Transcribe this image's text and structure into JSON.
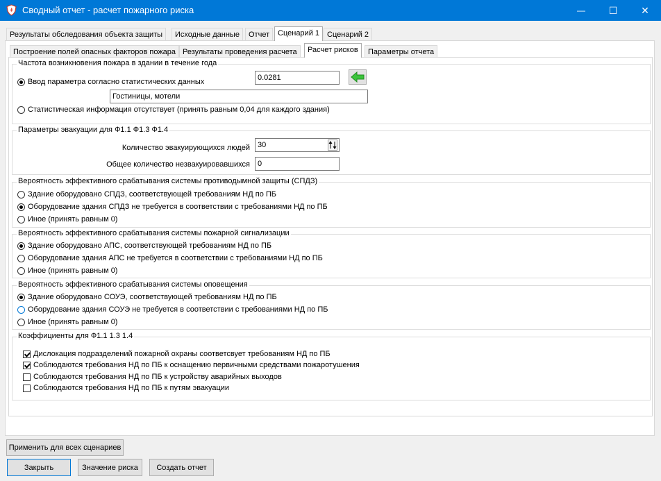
{
  "window": {
    "title": "Сводный отчет - расчет пожарного риска",
    "minimize_glyph": "—",
    "maximize_glyph": "☐",
    "close_glyph": "✕",
    "accent_color": "#0078d7"
  },
  "main_tabs": [
    {
      "label": "Результаты обследования объекта защиты"
    },
    {
      "label": "Исходные данные"
    },
    {
      "label": "Отчет"
    },
    {
      "label": "Сценарий 1"
    },
    {
      "label": "Сценарий 2"
    }
  ],
  "sub_tabs": [
    {
      "label": "Построение полей опасных факторов пожара"
    },
    {
      "label": "Результаты проведения расчета"
    },
    {
      "label": "Расчет рисков"
    },
    {
      "label": "Параметры отчета"
    }
  ],
  "fire_frequency": {
    "title": "Частота возникновения пожара в здании в течение года",
    "option_stats": "Ввод параметра согласно статистических данных",
    "value": "0.0281",
    "category": "Гостиницы, мотели",
    "option_no_stats": "Статистическая информация отсутствует (принять равным 0,04 для каждого здания)",
    "icon": "green-left-arrow-icon"
  },
  "evacuation": {
    "title": "Параметры эвакуации для Ф1.1 Ф1.3 Ф1.4",
    "evacuees_label": "Количество эвакуирующихся людей",
    "evacuees_value": "30",
    "not_evacuated_label": "Общее количество незвакуировавшихся",
    "not_evacuated_value": "0"
  },
  "spdz": {
    "title": "Вероятность эффективного срабатывания системы противодымной защиты (СПДЗ)",
    "options": [
      "Здание оборудовано СПДЗ, соответствующей требованиям НД по ПБ",
      "Оборудование здания СПДЗ не требуется в соответствии с требованиями НД по ПБ",
      "Иное (принять равным 0)"
    ]
  },
  "aps": {
    "title": "Вероятность эффективного срабатывания системы пожарной сигнализации",
    "options": [
      "Здание оборудовано АПС, соответствующей требованиям НД по ПБ",
      "Оборудование здания АПС не требуется в соответствии с требованиями НД по ПБ",
      "Иное (принять равным 0)"
    ]
  },
  "soue": {
    "title": "Вероятность эффективного срабатывания системы оповещения",
    "options": [
      "Здание оборудовано СОУЭ, соответствующей требованиям НД по ПБ",
      "Оборудование здания СОУЭ не требуется в соответствии с требованиями НД по ПБ",
      "Иное (принять равным 0)"
    ]
  },
  "coefficients": {
    "title": "Коэффициенты для Ф1.1 1.3 1.4",
    "items": [
      "Дислокация подразделений пожарной охраны соответсвует требованиям НД по ПБ",
      "Соблюдаются требования НД по ПБ к оснащению первичными средствами пожаротушения",
      "Соблюдаются требования НД по ПБ к устройству аварийных выходов",
      "Соблюдаются требования НД по ПБ к путям эвакуации"
    ]
  },
  "buttons": {
    "apply_all": "Применить для всех сценариев",
    "close": "Закрыть",
    "risk_value": "Значение риска",
    "create_report": "Создать отчет"
  }
}
